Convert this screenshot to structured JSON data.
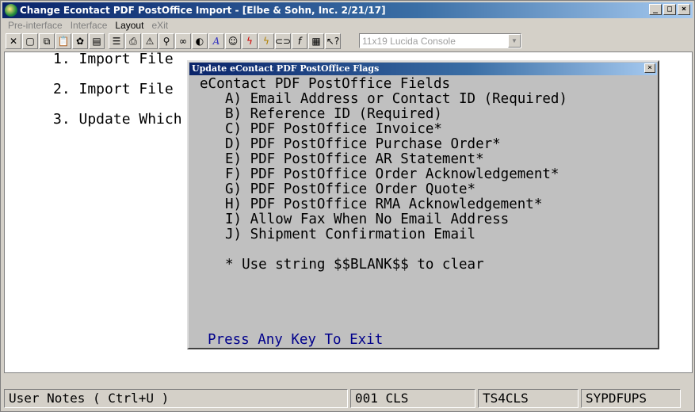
{
  "window": {
    "title": "Change Econtact PDF PostOffice Import - [Elbe & Sohn, Inc. 2/21/17]",
    "controls": {
      "minimize": "_",
      "maximize": "□",
      "close": "×"
    }
  },
  "menubar": [
    {
      "label": "Pre-interface",
      "enabled": false
    },
    {
      "label": "Interface",
      "enabled": false
    },
    {
      "label": "Layout",
      "enabled": true
    },
    {
      "label": "eXit",
      "enabled": false
    }
  ],
  "toolbar": {
    "icons": [
      "close-x",
      "blank-page",
      "copy",
      "paste",
      "settings",
      "properties",
      "notes",
      "printer-setup",
      "alert",
      "search",
      "binoculars",
      "color",
      "font",
      "user",
      "lightning",
      "run",
      "link",
      "script",
      "calculator",
      "help-cursor"
    ],
    "font_select": {
      "value": "11x19 Lucida Console"
    }
  },
  "main_menu": [
    "1. Import File",
    "2. Import File",
    "3. Update Which"
  ],
  "dialog": {
    "title": "Update eContact PDF PostOffice Flags",
    "close_label": "×",
    "heading": "eContact PDF PostOffice Fields",
    "options": [
      "A) Email Address or Contact ID (Required)",
      "B) Reference ID (Required)",
      "C) PDF PostOffice Invoice*",
      "D) PDF PostOffice Purchase Order*",
      "E) PDF PostOffice AR Statement*",
      "F) PDF PostOffice Order Acknowledgement*",
      "G) PDF PostOffice Order Quote*",
      "H) PDF PostOffice RMA Acknowledgement*",
      "I) Allow Fax When No Email Address",
      "J) Shipment Confirmation Email"
    ],
    "note": "* Use string $$BLANK$$ to clear",
    "footer": "Press Any Key To Exit"
  },
  "statusbar": {
    "notes": "User Notes ( Ctrl+U )",
    "code": "001 CLS",
    "terminal": "TS4CLS",
    "program": "SYPDFUPS"
  }
}
